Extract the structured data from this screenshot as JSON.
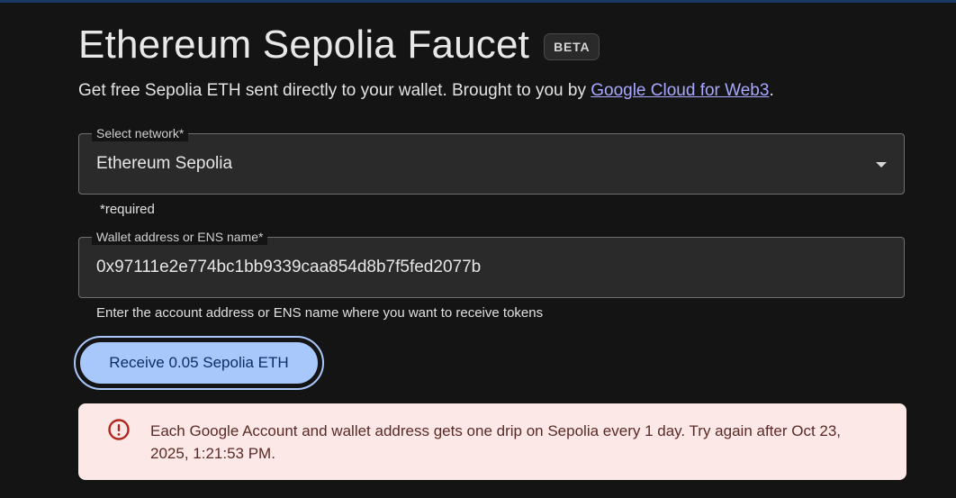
{
  "header": {
    "title": "Ethereum Sepolia Faucet",
    "badge": "BETA",
    "subtitle_prefix": "Get free Sepolia ETH sent directly to your wallet. Brought to you by ",
    "subtitle_link": "Google Cloud for Web3",
    "subtitle_suffix": "."
  },
  "network_field": {
    "label": "Select network*",
    "value": "Ethereum Sepolia",
    "helper": "*required",
    "icon": "chevron-down-icon"
  },
  "wallet_field": {
    "label": "Wallet address or ENS name*",
    "value": "0x97111e2e774bc1bb9339caa854d8b7f5fed2077b",
    "helper": "Enter the account address or ENS name where you want to receive tokens"
  },
  "receive_button": {
    "label": "Receive 0.05 Sepolia ETH"
  },
  "alert": {
    "icon": "error-circle-icon",
    "message": "Each Google Account and wallet address gets one drip on Sepolia every 1 day. Try again after Oct 23, 2025, 1:21:53 PM."
  },
  "colors": {
    "background": "#141414",
    "accent": "#a8c7fa",
    "link": "#a8a8ff",
    "alert_bg": "#fce8e6",
    "alert_icon": "#b3261e"
  }
}
